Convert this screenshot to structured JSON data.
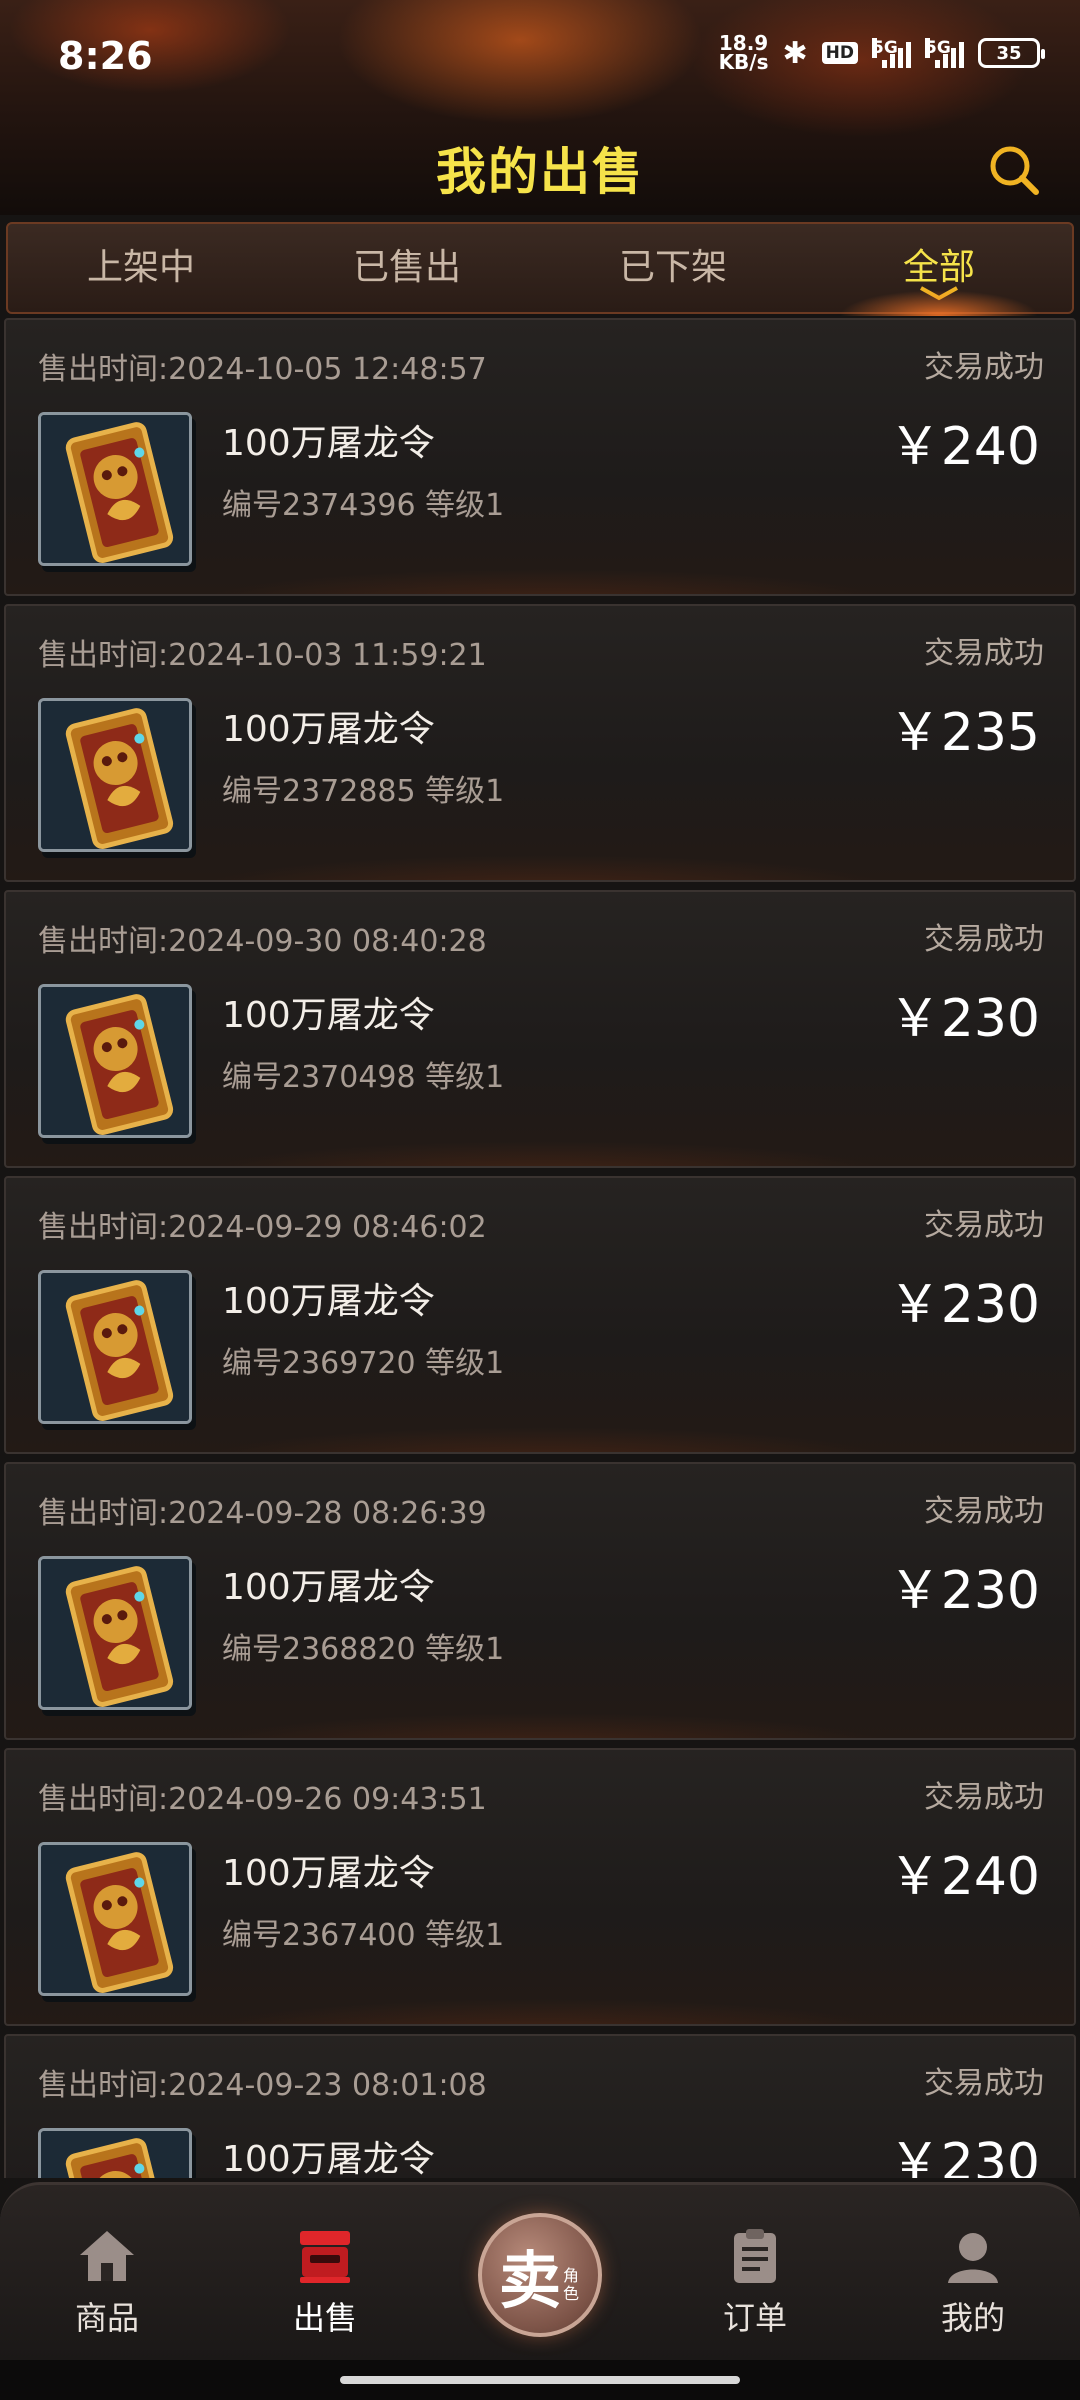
{
  "status_bar": {
    "time": "8:26",
    "net_speed_value": "18.9",
    "net_speed_unit": "KB/s",
    "hd_label": "HD",
    "sim1_label": "5G",
    "sim2_label": "5G",
    "battery": "35"
  },
  "header": {
    "title": "我的出售"
  },
  "tabs": [
    {
      "label": "上架中",
      "active": false
    },
    {
      "label": "已售出",
      "active": false
    },
    {
      "label": "已下架",
      "active": false
    },
    {
      "label": "全部",
      "active": true
    }
  ],
  "orders": [
    {
      "sold_time": "售出时间:2024-10-05 12:48:57",
      "status": "交易成功",
      "name": "100万屠龙令",
      "meta": "编号2374396 等级1",
      "price": "￥240"
    },
    {
      "sold_time": "售出时间:2024-10-03 11:59:21",
      "status": "交易成功",
      "name": "100万屠龙令",
      "meta": "编号2372885 等级1",
      "price": "￥235"
    },
    {
      "sold_time": "售出时间:2024-09-30 08:40:28",
      "status": "交易成功",
      "name": "100万屠龙令",
      "meta": "编号2370498 等级1",
      "price": "￥230"
    },
    {
      "sold_time": "售出时间:2024-09-29 08:46:02",
      "status": "交易成功",
      "name": "100万屠龙令",
      "meta": "编号2369720 等级1",
      "price": "￥230"
    },
    {
      "sold_time": "售出时间:2024-09-28 08:26:39",
      "status": "交易成功",
      "name": "100万屠龙令",
      "meta": "编号2368820 等级1",
      "price": "￥230"
    },
    {
      "sold_time": "售出时间:2024-09-26 09:43:51",
      "status": "交易成功",
      "name": "100万屠龙令",
      "meta": "编号2367400 等级1",
      "price": "￥240"
    },
    {
      "sold_time": "售出时间:2024-09-23 08:01:08",
      "status": "交易成功",
      "name": "100万屠龙令",
      "meta": "",
      "price": "￥230"
    }
  ],
  "bottom_nav": {
    "home_label": "商品",
    "sell_label": "出售",
    "center_main": "卖",
    "center_sub": "角色",
    "orders_label": "订单",
    "mine_label": "我的"
  },
  "colors": {
    "title": "#f6e34a",
    "active_tab": "#f6e34a",
    "sell_active": "#e0262a"
  },
  "icons": {
    "search": "search-icon",
    "item": "dragon-token-icon",
    "home": "home-icon",
    "sell": "shop-icon",
    "center": "sell-role-button",
    "orders": "clipboard-icon",
    "mine": "user-icon"
  }
}
